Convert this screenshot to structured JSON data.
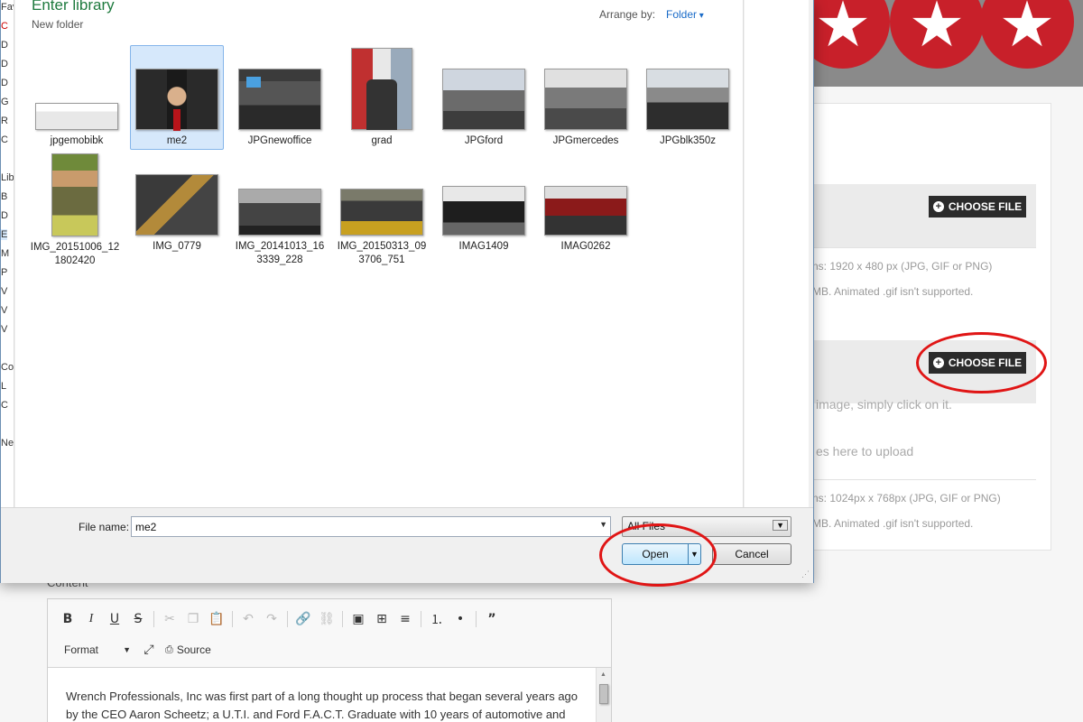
{
  "background": {
    "choose_file_label": "CHOOSE FILE",
    "upload1_hint_dims": "ns: 1920 x 480 px (JPG, GIF or PNG)",
    "upload1_hint_size": "MB. Animated .gif isn't supported.",
    "upload2_click_hint": "image, simply click on it.",
    "upload2_drop_hint": "es here to upload",
    "upload2_hint_dims": "ns: 1024px x 768px (JPG, GIF or PNG)",
    "upload2_hint_size": "MB. Animated .gif isn't supported.",
    "content_label": "Content",
    "editor": {
      "format_label": "Format",
      "source_label": "Source",
      "body_text": "Wrench Professionals, Inc was first part of a long thought up process that began several years ago by the CEO Aaron Scheetz; a U.T.I. and Ford F.A.C.T. Graduate with 10 years of automotive and"
    }
  },
  "dialog": {
    "library_title": "Enter library",
    "library_subtitle": "New folder",
    "arrange_by_label": "Arrange by:",
    "arrange_by_value": "Folder",
    "nav_fragments": [
      "Fav",
      "C",
      "D",
      "D",
      "D",
      "G",
      "R",
      "C",
      "Lib",
      "B",
      "D",
      "E",
      "M",
      "P",
      "V",
      "V",
      "V",
      "Co",
      "L",
      "C",
      "Ne"
    ],
    "files": [
      {
        "name": "jpgemobibk"
      },
      {
        "name": "me2",
        "selected": true
      },
      {
        "name": "JPGnewoffice"
      },
      {
        "name": "grad"
      },
      {
        "name": "JPGford"
      },
      {
        "name": "JPGmercedes"
      },
      {
        "name": "JPGblk350z"
      },
      {
        "name": "IMG_20151006_121802420"
      },
      {
        "name": "IMG_0779"
      },
      {
        "name": "IMG_20141013_163339_228"
      },
      {
        "name": "IMG_20150313_093706_751"
      },
      {
        "name": "IMAG1409"
      },
      {
        "name": "IMAG0262"
      }
    ],
    "file_name_label": "File name:",
    "file_name_value": "me2",
    "file_type_value": "All Files",
    "open_label": "Open",
    "cancel_label": "Cancel"
  },
  "colors": {
    "highlight": "#e01515",
    "library_title": "#1e7a3e",
    "link": "#1a6bc8",
    "star_red": "#c8202a"
  }
}
